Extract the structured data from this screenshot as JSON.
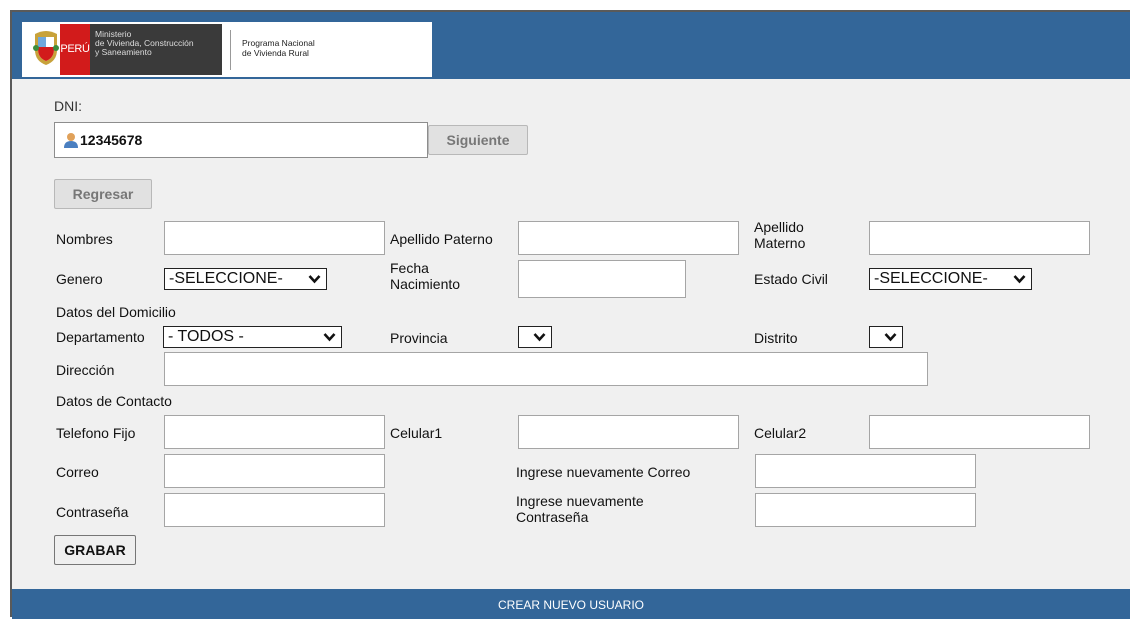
{
  "header": {
    "peru_label": "PERÚ",
    "ministry_lines": [
      "Ministerio",
      "de Vivienda, Construcción",
      "y Saneamiento"
    ],
    "program_lines": [
      "Programa Nacional",
      "de Vivienda Rural"
    ],
    "bar_color": "#336699"
  },
  "dni": {
    "label": "DNI:",
    "value": "12345678",
    "next_button": "Siguiente",
    "back_button": "Regresar"
  },
  "form": {
    "nombres": "Nombres",
    "apellido_paterno": "Apellido Paterno",
    "apellido_materno_1": "Apellido",
    "apellido_materno_2": "Materno",
    "genero": "Genero",
    "genero_value": "-SELECCIONE-",
    "fecha_1": "Fecha",
    "fecha_2": "Nacimiento",
    "estado_civil": "Estado Civil",
    "estado_civil_value": "-SELECCIONE-",
    "domicilio_section": "Datos del Domicilio",
    "departamento": "Departamento",
    "departamento_value": "- TODOS -",
    "provincia": "Provincia",
    "distrito": "Distrito",
    "direccion": "Dirección",
    "contacto_section": "Datos de Contacto",
    "telefono_fijo": "Telefono Fijo",
    "celular1": "Celular1",
    "celular2": "Celular2",
    "correo": "Correo",
    "correo_repeat": "Ingrese nuevamente Correo",
    "contrasena": "Contraseña",
    "contrasena_repeat_1": "Ingrese nuevamente",
    "contrasena_repeat_2": "Contraseña",
    "save_button": "GRABAR"
  },
  "footer": {
    "title": "CREAR NUEVO USUARIO"
  },
  "icons": [
    "peru-shield-icon",
    "user-icon",
    "chevron-down-icon"
  ]
}
